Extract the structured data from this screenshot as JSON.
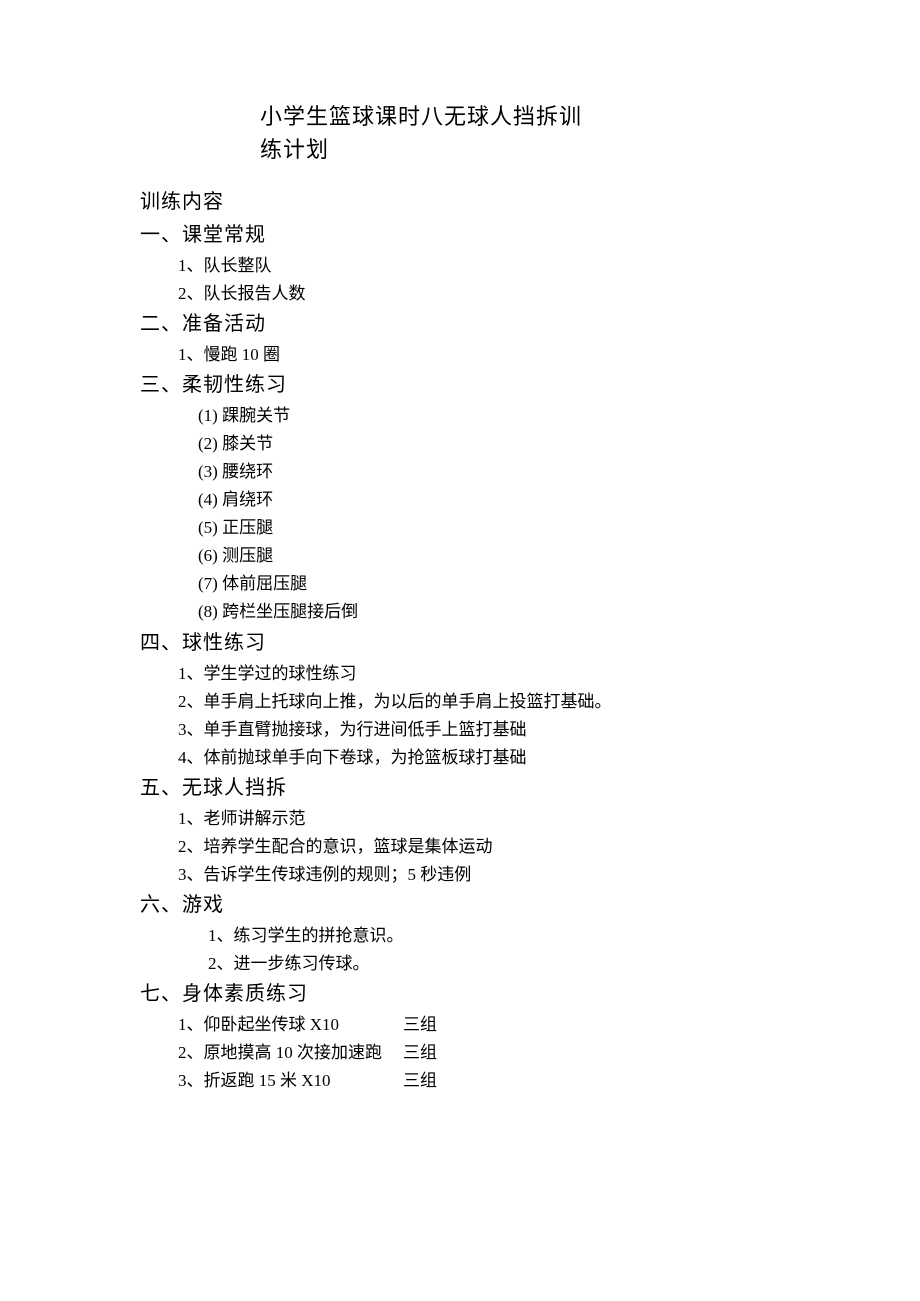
{
  "title": {
    "line1": "小学生篮球课时八无球人挡拆训",
    "line2": "练计划"
  },
  "content_heading": "训练内容",
  "sections": {
    "s1": {
      "heading": "一、课堂常规",
      "items": {
        "i1": "1、队长整队",
        "i2": "2、队长报告人数"
      }
    },
    "s2": {
      "heading": "二、准备活动",
      "items": {
        "i1": "1、慢跑 10 圈"
      }
    },
    "s3": {
      "heading": "三、柔韧性练习",
      "items": {
        "i1": "(1) 踝腕关节",
        "i2": "(2) 膝关节",
        "i3": "(3) 腰绕环",
        "i4": "(4) 肩绕环",
        "i5": "(5) 正压腿",
        "i6": "(6) 测压腿",
        "i7": "(7) 体前屈压腿",
        "i8": "(8) 跨栏坐压腿接后倒"
      }
    },
    "s4": {
      "heading": "四、球性练习",
      "items": {
        "i1": "1、学生学过的球性练习",
        "i2": "2、单手肩上托球向上推，为以后的单手肩上投篮打基础。",
        "i3": "3、单手直臂抛接球，为行进间低手上篮打基础",
        "i4": "4、体前抛球单手向下卷球，为抢篮板球打基础"
      }
    },
    "s5": {
      "heading": "五、无球人挡拆",
      "items": {
        "i1": "1、老师讲解示范",
        "i2": "2、培养学生配合的意识，篮球是集体运动",
        "i3": "3、告诉学生传球违例的规则；5 秒违例"
      }
    },
    "s6": {
      "heading": "六、游戏",
      "items": {
        "i1": "1、练习学生的拼抢意识。",
        "i2": "2、进一步练习传球。"
      }
    },
    "s7": {
      "heading": "七、身体素质练习",
      "items": {
        "i1": {
          "left": "1、仰卧起坐传球 X10",
          "right": "三组"
        },
        "i2": {
          "left": "2、原地摸高 10 次接加速跑",
          "right": "三组"
        },
        "i3": {
          "left": "3、折返跑 15 米 X10",
          "right": "三组"
        }
      }
    }
  }
}
